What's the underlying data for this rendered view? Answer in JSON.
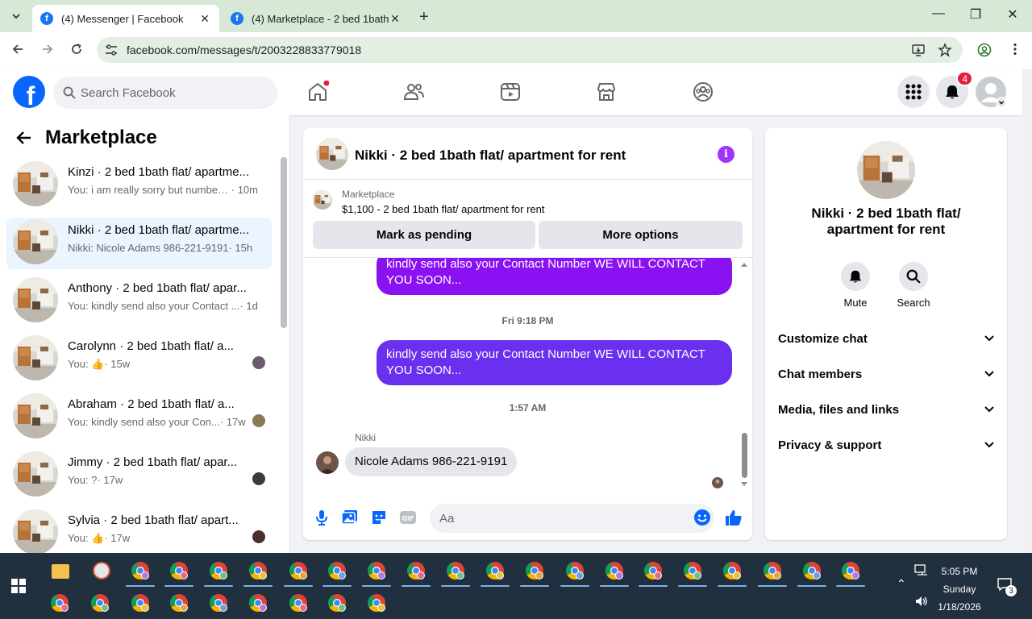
{
  "browser": {
    "tabs": [
      {
        "title": "(4) Messenger | Facebook",
        "active": true
      },
      {
        "title": "(4) Marketplace - 2 bed 1bath f",
        "active": false
      }
    ],
    "url": "facebook.com/messages/t/2003228833779018"
  },
  "header": {
    "search_placeholder": "Search Facebook",
    "notifications_count": "4",
    "brand_color": "#0866ff"
  },
  "left": {
    "title": "Marketplace",
    "chats": [
      {
        "name": "Kinzi · 2 bed 1bath flat/ apartme...",
        "preview": "You: i am really sorry but number ...",
        "time": "· 10m",
        "selected": false
      },
      {
        "name": "Nikki · 2 bed 1bath flat/ apartme...",
        "preview": "Nikki: Nicole Adams 986-221-9191",
        "time": " · 15h",
        "selected": true
      },
      {
        "name": "Anthony · 2 bed 1bath flat/ apar...",
        "preview": "You: kindly send also your Contact ...",
        "time": " · 1d",
        "selected": false
      },
      {
        "name": "Carolynn · 2 bed 1bath flat/ a...",
        "preview": "You: 👍",
        "time": " · 15w",
        "selected": false
      },
      {
        "name": "Abraham · 2 bed 1bath flat/ a...",
        "preview": "You: kindly send also your Con...",
        "time": " · 17w",
        "selected": false
      },
      {
        "name": "Jimmy · 2 bed 1bath flat/ apar...",
        "preview": "You: ?",
        "time": " · 17w",
        "selected": false
      },
      {
        "name": "Sylvia · 2 bed 1bath flat/ apart...",
        "preview": "You: 👍",
        "time": " · 17w",
        "selected": false
      }
    ]
  },
  "conversation": {
    "title": "Nikki · 2 bed 1bath flat/ apartment for rent",
    "listing_label": "Marketplace",
    "listing_price": "$1,100 - 2 bed 1bath flat/ apartment for rent",
    "mark_pending": "Mark as pending",
    "more_options": "More options",
    "messages": {
      "out1": "kindly send also your Contact Number  WE WILL CONTACT YOU SOON...",
      "time1": "Fri 9:18 PM",
      "out2": "kindly send also your Contact Number  WE WILL CONTACT YOU SOON...",
      "time2": "1:57 AM",
      "sender": "Nikki",
      "in1": "Nicole Adams 986-221-9191"
    },
    "composer_placeholder": "Aa",
    "accent": "#a033ff"
  },
  "right": {
    "name": "Nikki · 2 bed 1bath flat/ apartment for rent",
    "mute": "Mute",
    "search": "Search",
    "sections": [
      "Customize chat",
      "Chat members",
      "Media, files and links",
      "Privacy & support"
    ]
  },
  "taskbar": {
    "time": "5:05 PM",
    "day": "Sunday",
    "date": "1/18/2026",
    "notif_count": "3"
  }
}
